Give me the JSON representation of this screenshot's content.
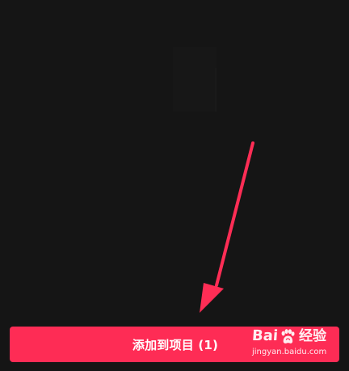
{
  "screen": {
    "background": "#151515"
  },
  "annotation": {
    "arrow_color": "#ff2d55",
    "icon": "red-arrow-icon"
  },
  "action": {
    "add_to_project_label": "添加到项目 (1)",
    "button_color": "#fe2c55"
  },
  "watermark": {
    "brand_left": "Bai",
    "brand_right": "经验",
    "domain": "jingyan.baidu.com",
    "icon": "paw-icon"
  }
}
